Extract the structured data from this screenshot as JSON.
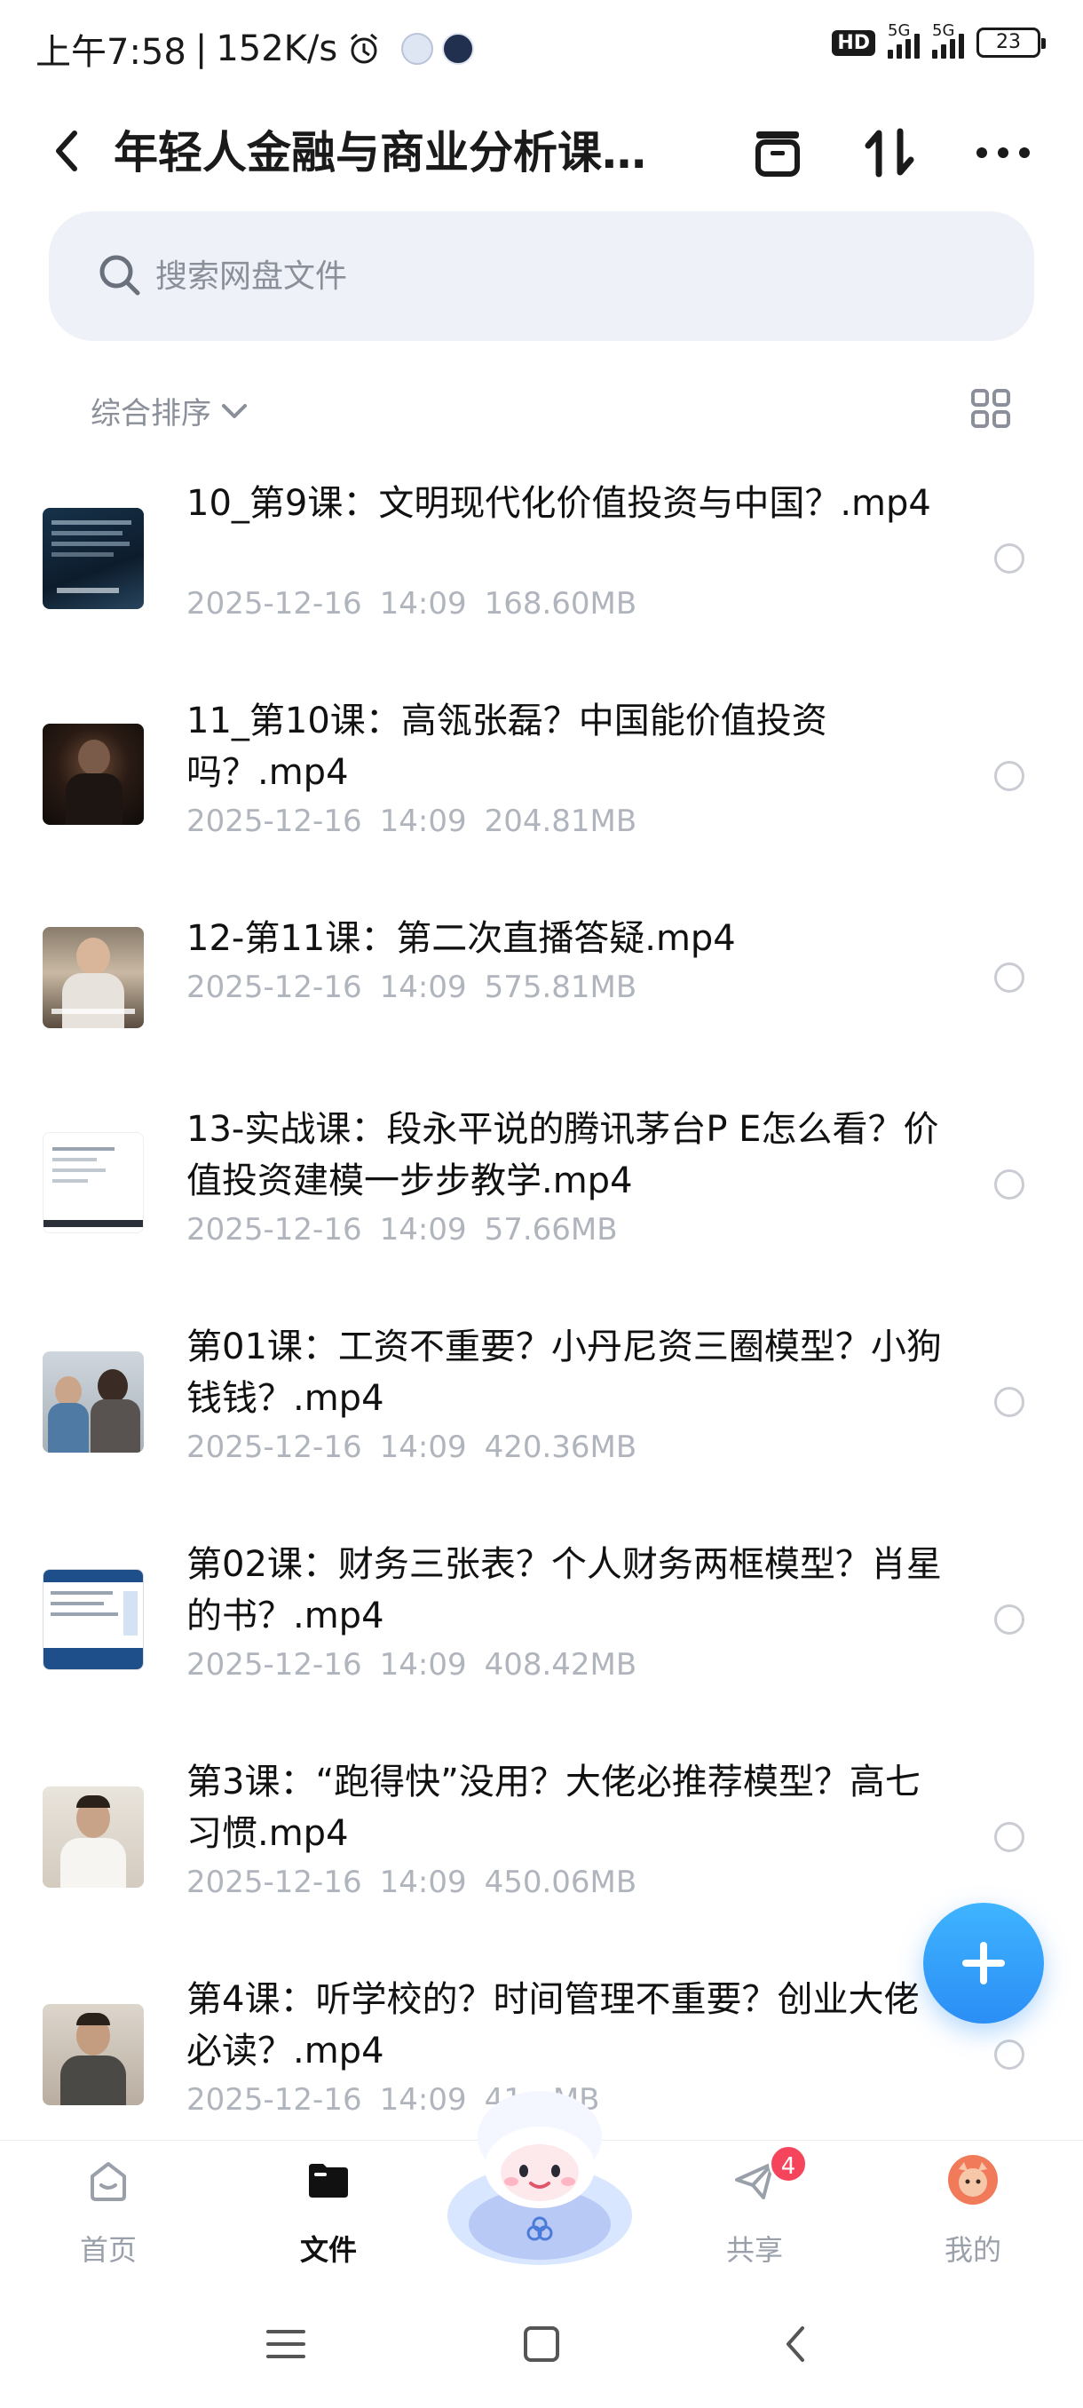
{
  "status_bar": {
    "time": "上午7:58",
    "speed": "152K/s",
    "network_1": "5G",
    "network_2": "5G",
    "battery": "23"
  },
  "header": {
    "title": "年轻人金融与商业分析课..."
  },
  "search": {
    "placeholder": "搜索网盘文件"
  },
  "sort": {
    "label": "综合排序"
  },
  "files": [
    {
      "name": "10_第9课：文明现代化价值投资与中国？.mp4",
      "date": "2025-12-16",
      "time": "14:09",
      "size": "168.60MB",
      "thumb": "thumb-dark-blue"
    },
    {
      "name": "11_第10课：高瓴张磊？中国能价值投资吗？.mp4",
      "date": "2025-12-16",
      "time": "14:09",
      "size": "204.81MB",
      "thumb": "thumb-dark-stage"
    },
    {
      "name": "12-第11课：第二次直播答疑.mp4",
      "date": "2025-12-16",
      "time": "14:09",
      "size": "575.81MB",
      "thumb": "thumb-person-room"
    },
    {
      "name": "13-实战课：段永平说的腾讯茅台P E怎么看？价值投资建模一步步教学.mp4",
      "date": "2025-12-16",
      "time": "14:09",
      "size": "57.66MB",
      "thumb": "thumb-document"
    },
    {
      "name": "第01课：工资不重要？小丹尼资三圈模型？小狗钱钱？.mp4",
      "date": "2025-12-16",
      "time": "14:09",
      "size": "420.36MB",
      "thumb": "thumb-people"
    },
    {
      "name": "第02课：财务三张表？个人财务两框模型？肖星的书？.mp4",
      "date": "2025-12-16",
      "time": "14:09",
      "size": "408.42MB",
      "thumb": "thumb-slides"
    },
    {
      "name": "第3课：“跑得快”没用？大佬必推荐模型？高七习惯.mp4",
      "date": "2025-12-16",
      "time": "14:09",
      "size": "450.06MB",
      "thumb": "thumb-speaker"
    },
    {
      "name": "第4课：听学校的？时间管理不重要？创业大佬必读？.mp4",
      "date": "2025-12-16",
      "time": "14:09",
      "size": "41__MB",
      "thumb": "thumb-speaker-2"
    }
  ],
  "bottom_nav": {
    "home": "首页",
    "files": "文件",
    "share": "共享",
    "share_badge": "4",
    "me": "我的"
  }
}
